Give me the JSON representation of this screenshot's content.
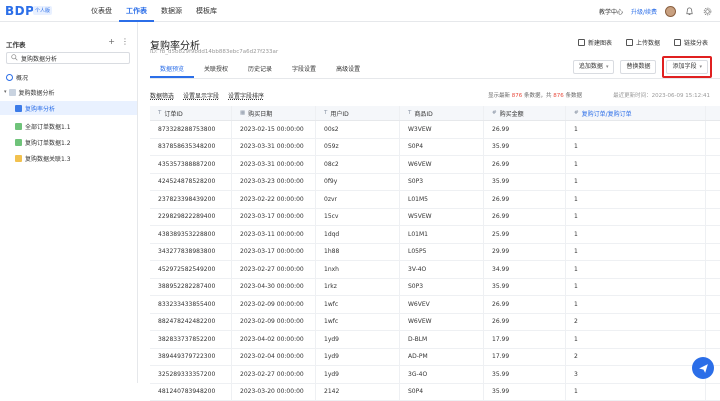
{
  "topbar": {
    "logo": "BDP",
    "badge": "个人版",
    "nav": [
      "仪表盘",
      "工作表",
      "数据源",
      "模板库"
    ],
    "active_nav": 1,
    "help": "教学中心",
    "upgrade": "升级/续费"
  },
  "sidebar": {
    "title": "工作表",
    "search_value": "复购数据分析",
    "items": [
      {
        "label": "概况",
        "icon": "chart-icon"
      },
      {
        "label": "复购数据分析",
        "icon": "folder-icon"
      },
      {
        "label": "复购率分析",
        "icon": "sheet-icon"
      },
      {
        "label": "全部订单数据1.1",
        "icon": "sheet-icon"
      },
      {
        "label": "复购订单数据1.2",
        "icon": "sheet-icon"
      },
      {
        "label": "复购数据关联1.3",
        "icon": "sheet-icon"
      }
    ]
  },
  "main": {
    "title": "复购率分析",
    "id_text": "ID: rb_d5b829f9bdd14bb883ebc7a6d27f233ar",
    "actions": [
      "新建图表",
      "上传数据",
      "链接分表"
    ],
    "tabs": [
      "数据预览",
      "关联授权",
      "历史记录",
      "字段设置",
      "高级设置"
    ],
    "active_tab": 0,
    "tool_buttons": {
      "add_data": "追加数据",
      "replace_data": "替换数据",
      "add_field": "添加字段"
    },
    "filters": [
      "数据筛选",
      "设置显示字段",
      "设置字段排序"
    ],
    "stats": {
      "prefix": "显示最新",
      "shown": "876",
      "mid": "条数据，共",
      "total": "876",
      "suffix": "条数据"
    },
    "updated": "最近更新时间：2023-06-09 15:12:41"
  },
  "table": {
    "headers": [
      "订单ID",
      "购买日期",
      "用户ID",
      "商品ID",
      "购买金额",
      "复购订单/复购订单"
    ],
    "header_types": [
      "T",
      "▦",
      "T",
      "T",
      "#",
      "#"
    ],
    "rows": [
      [
        "873328288753800",
        "2023-02-15 00:00:00",
        "00s2",
        "W3VEW",
        "26.99",
        "1"
      ],
      [
        "837858635348200",
        "2023-03-31 00:00:00",
        "059z",
        "S0P4",
        "35.99",
        "1"
      ],
      [
        "435357388887200",
        "2023-03-31 00:00:00",
        "08c2",
        "W6VEW",
        "26.99",
        "1"
      ],
      [
        "424524878528200",
        "2023-03-23 00:00:00",
        "0f9y",
        "S0P3",
        "35.99",
        "1"
      ],
      [
        "237823398439200",
        "2023-02-22 00:00:00",
        "0zvr",
        "L01M5",
        "26.99",
        "1"
      ],
      [
        "229829822289400",
        "2023-03-17 00:00:00",
        "15cv",
        "W5VEW",
        "26.99",
        "1"
      ],
      [
        "438389353228800",
        "2023-03-11 00:00:00",
        "1dqd",
        "L01M1",
        "25.99",
        "1"
      ],
      [
        "343277838983800",
        "2023-03-17 00:00:00",
        "1h88",
        "L05P5",
        "29.99",
        "1"
      ],
      [
        "452972582549200",
        "2023-02-27 00:00:00",
        "1nxh",
        "3V-4O",
        "34.99",
        "1"
      ],
      [
        "388952282287400",
        "2023-04-30 00:00:00",
        "1rkz",
        "S0P3",
        "35.99",
        "1"
      ],
      [
        "833233433855400",
        "2023-02-09 00:00:00",
        "1wfc",
        "W6VEV",
        "26.99",
        "1"
      ],
      [
        "882478242482200",
        "2023-02-09 00:00:00",
        "1wfc",
        "W6VEW",
        "26.99",
        "2"
      ],
      [
        "382833737852200",
        "2023-04-02 00:00:00",
        "1yd9",
        "D-BLM",
        "17.99",
        "1"
      ],
      [
        "389449379722300",
        "2023-02-04 00:00:00",
        "1yd9",
        "AD-PM",
        "17.99",
        "2"
      ],
      [
        "325289333357200",
        "2023-02-27 00:00:00",
        "1yd9",
        "3G-4O",
        "35.99",
        "3"
      ],
      [
        "481240783948200",
        "2023-03-20 00:00:00",
        "2142",
        "S0P4",
        "35.99",
        "1"
      ]
    ]
  }
}
